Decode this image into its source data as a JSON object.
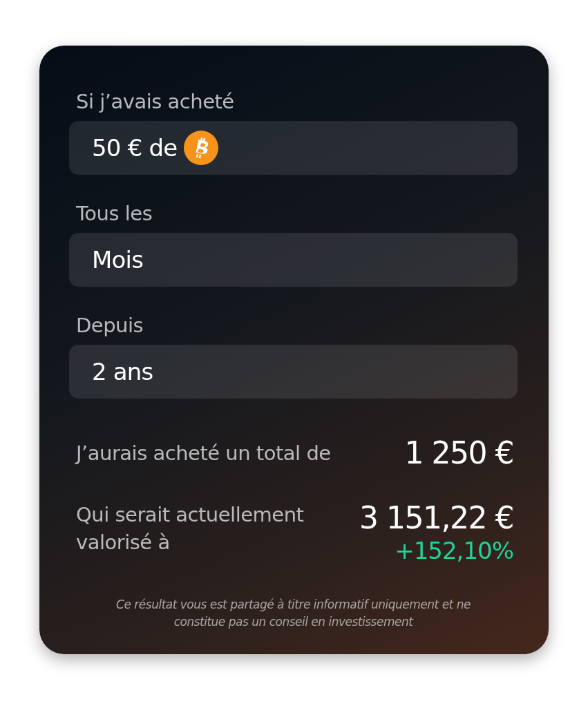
{
  "fields": [
    {
      "label": "Si j’avais acheté",
      "value": "50 € de",
      "kind": "coin"
    },
    {
      "label": "Tous les",
      "value": "Mois",
      "kind": "text"
    },
    {
      "label": "Depuis",
      "value": "2 ans",
      "kind": "text"
    }
  ],
  "results": [
    {
      "label": "J’aurais acheté un total de",
      "value": "1 250 €"
    },
    {
      "label": "Qui serait actuellement valorisé à",
      "value": "3 151,22 €",
      "change": "+152,10%"
    }
  ],
  "disclaimer": "Ce résultat vous est partagé à titre informatif uniquement et ne constitue pas un conseil en investissement"
}
